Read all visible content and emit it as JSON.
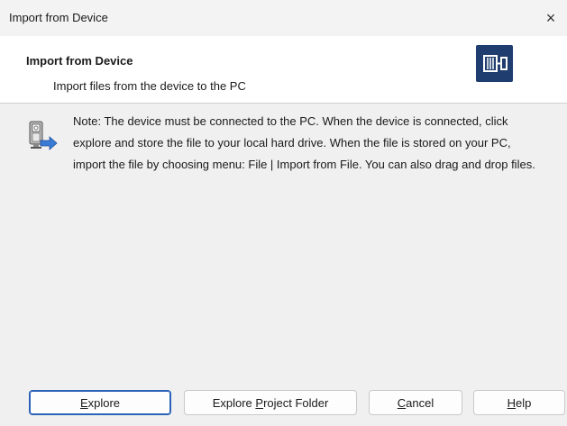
{
  "window": {
    "title": "Import from Device",
    "close_glyph": "×"
  },
  "header": {
    "title": "Import from Device",
    "subtitle": "Import files from the device to the PC",
    "icon": "device-import-icon"
  },
  "note": {
    "icon": "device-transfer-icon",
    "text": "Note: The device must be connected to the PC. When the device is connected, click explore and store the file to your local hard drive. When the file is stored on your PC, import the file by choosing menu: File | Import from File. You can also drag and drop files."
  },
  "buttons": {
    "explore": {
      "pre": "",
      "key": "E",
      "post": "xplore"
    },
    "explore_project": {
      "pre": "Explore ",
      "key": "P",
      "post": "roject Folder"
    },
    "cancel": {
      "pre": "",
      "key": "C",
      "post": "ancel"
    },
    "help": {
      "pre": "",
      "key": "H",
      "post": "elp"
    }
  },
  "colors": {
    "accent": "#1f3d6e",
    "primary_border": "#2a62b8",
    "content_bg": "#f0f0f0"
  }
}
